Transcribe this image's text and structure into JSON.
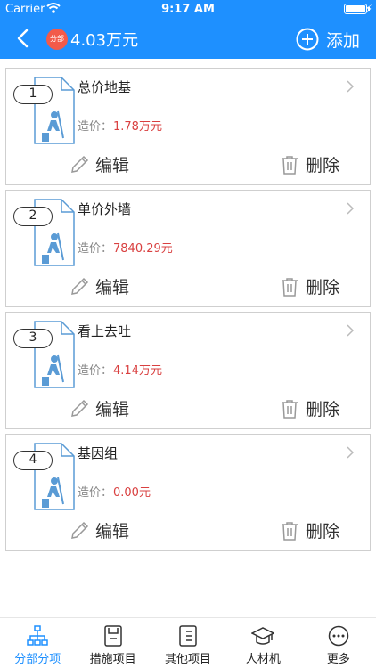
{
  "status_bar": {
    "carrier": "Carrier",
    "time": "9:17 AM"
  },
  "nav": {
    "badge": "分部",
    "title": "4.03万元",
    "add_label": "添加"
  },
  "labels": {
    "cost_label": "造价：",
    "edit": "编辑",
    "delete": "删除"
  },
  "items": [
    {
      "num": "1",
      "title": "总价地基",
      "cost": "1.78万元"
    },
    {
      "num": "2",
      "title": "单价外墙",
      "cost": "7840.29元"
    },
    {
      "num": "3",
      "title": "看上去吐",
      "cost": "4.14万元"
    },
    {
      "num": "4",
      "title": "基因组",
      "cost": "0.00元"
    }
  ],
  "tabs": [
    {
      "label": "分部分项",
      "icon": "hierarchy-icon",
      "active": true
    },
    {
      "label": "措施项目",
      "icon": "document-icon",
      "active": false
    },
    {
      "label": "其他项目",
      "icon": "list-icon",
      "active": false
    },
    {
      "label": "人材机",
      "icon": "graduation-cap-icon",
      "active": false
    },
    {
      "label": "更多",
      "icon": "more-icon",
      "active": false
    }
  ],
  "colors": {
    "primary": "#1e90ff",
    "cost": "#d94040",
    "badge": "#f25a4a"
  }
}
